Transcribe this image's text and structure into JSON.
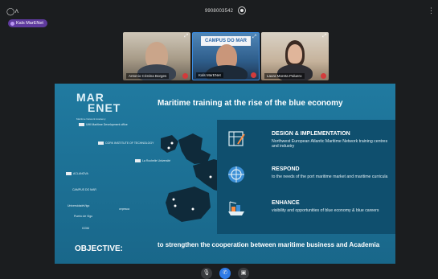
{
  "topbar": {
    "people_icon": "people-icon",
    "meeting_id": "9908003542",
    "record_icon": "record-icon",
    "more_icon": "more-icon"
  },
  "host_chip": {
    "label": "Kals MarENet"
  },
  "participants": [
    {
      "name": "Antonio Cristina Borges",
      "muted": true
    },
    {
      "name": "Kals MarENet",
      "muted": true,
      "background_text": "CAMPUS DO MAR"
    },
    {
      "name": "Laura Moreta Paluero",
      "muted": true
    }
  ],
  "slide": {
    "logo_top": "MAR",
    "logo_bottom": "ENET",
    "logo_tagline": "Maritime Network Academy",
    "title": "Maritime training at the rise of the blue economy",
    "partners": [
      "UMI Maritime Development office",
      "CORK INSTITUTE OF TECHNOLOGY",
      "La Rochelle Université",
      "ACLANOVA",
      "CAMPUS DO MAR",
      "UniversidadeVigo",
      "Puerto de Vigo",
      "ICDM",
      "cepesca"
    ],
    "items": [
      {
        "heading": "DESIGN & IMPLEMENTATION",
        "text": "Northwest European Atlantic Maritime Network training centres and industry"
      },
      {
        "heading": "RESPOND",
        "text": "to the needs of the port maritime market and maritime curricula"
      },
      {
        "heading": "ENHANCE",
        "text": "visibility and opportunities of blue economy & blue careers"
      }
    ],
    "objective_label": "OBJECTIVE:",
    "objective_text": "to strengthen the cooperation between maritime business and Academia"
  },
  "controls": {
    "mic_icon": "mic-off-icon",
    "end_icon": "end-call-icon",
    "screen_icon": "screen-share-icon"
  },
  "colors": {
    "background": "#1b1d1f",
    "slide": "#1c6f92",
    "panel": "#0f4f6e",
    "accent": "#2f7be6",
    "host_chip": "#5f3a9e",
    "mic_muted": "#d23b3b"
  }
}
